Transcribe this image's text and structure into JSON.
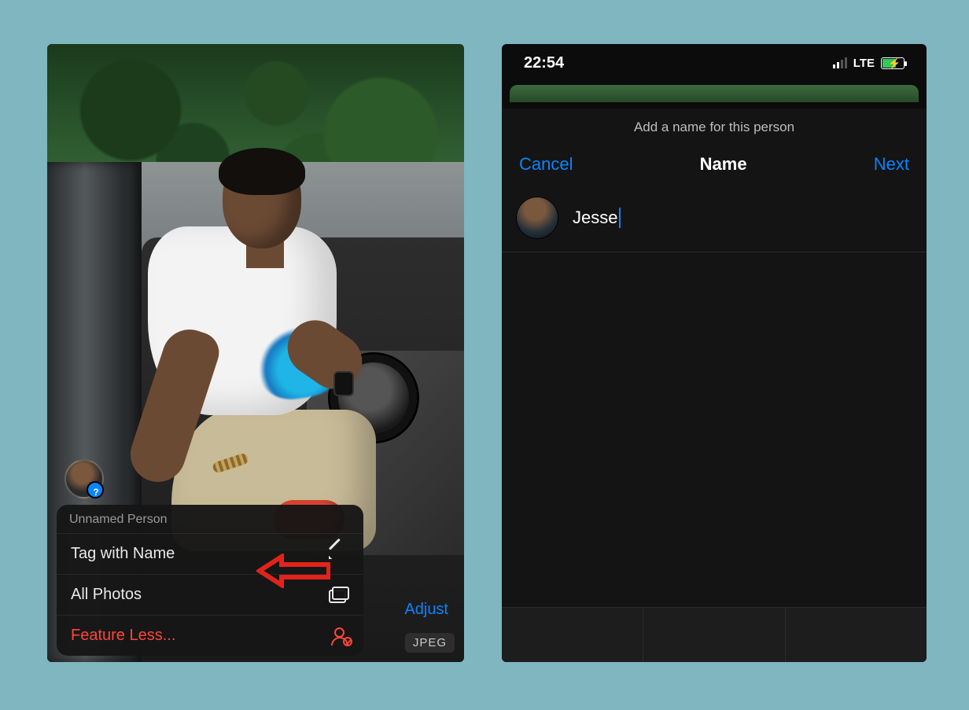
{
  "left": {
    "face_badge_glyph": "?",
    "menu_header": "Unnamed Person",
    "menu": {
      "tag": {
        "label": "Tag with Name",
        "icon_name": "pencil-icon"
      },
      "all": {
        "label": "All Photos",
        "icon_name": "stack-icon"
      },
      "less": {
        "label": "Feature Less...",
        "icon_name": "person-slash-icon"
      }
    },
    "adjust_label": "Adjust",
    "format_badge": "JPEG"
  },
  "right": {
    "status": {
      "time": "22:54",
      "network": "LTE"
    },
    "sheet": {
      "subtitle": "Add a name for this person",
      "cancel": "Cancel",
      "title": "Name",
      "next": "Next"
    },
    "input": {
      "value": "Jesse"
    }
  }
}
